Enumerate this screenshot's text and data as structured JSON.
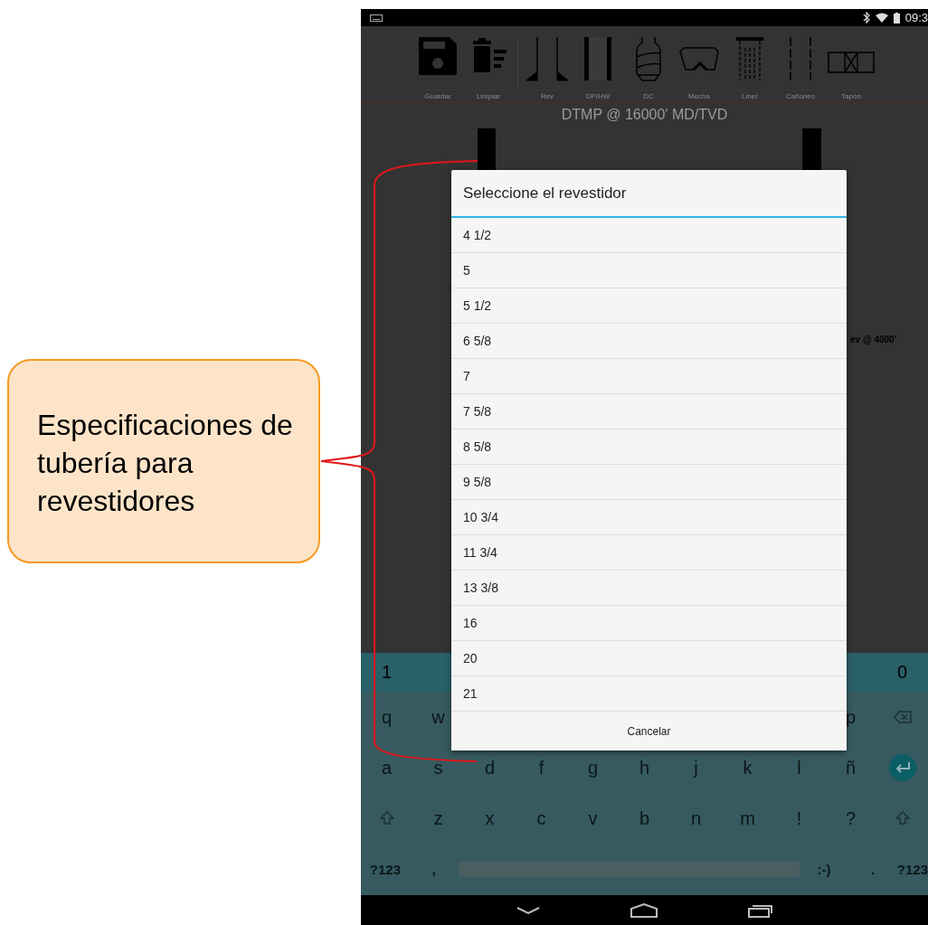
{
  "callout": {
    "text": "Especificaciones de tubería para revestidores"
  },
  "status_bar": {
    "time": "09:3"
  },
  "toolbar": {
    "file_tools": [
      {
        "label": "Guardar",
        "kind": "save"
      },
      {
        "label": "Limpiar",
        "kind": "clear"
      }
    ],
    "element_tools": [
      {
        "label": "Rev",
        "kind": "rev"
      },
      {
        "label": "DP/HW",
        "kind": "pipe"
      },
      {
        "label": "DC",
        "kind": "collar"
      },
      {
        "label": "Mecha",
        "kind": "bit"
      },
      {
        "label": "Liner",
        "kind": "liner"
      },
      {
        "label": "Cañoneo",
        "kind": "perforation"
      },
      {
        "label": "Tapón",
        "kind": "plug"
      }
    ]
  },
  "drawing": {
    "title": "DTMP @ 16000' MD/TVD",
    "depth_label": "ev @ 4000'"
  },
  "dialog": {
    "title": "Seleccione el revestidor",
    "options": [
      "4 1/2",
      "5",
      "5 1/2",
      "6 5/8",
      "7",
      "7 5/8",
      "8 5/8",
      "9 5/8",
      "10 3/4",
      "11 3/4",
      "13 3/8",
      "16",
      "20",
      "21"
    ],
    "cancel": "Cancelar"
  },
  "keyboard": {
    "rows": [
      {
        "kind": "number",
        "left": [
          {
            "kind": "char",
            "label": "1"
          }
        ],
        "right": [
          {
            "kind": "char",
            "label": "0"
          }
        ]
      },
      {
        "kind": "letter",
        "left": [
          {
            "kind": "char",
            "label": "q"
          },
          {
            "kind": "char",
            "label": "w"
          }
        ],
        "right": [
          {
            "kind": "char",
            "label": "p"
          },
          {
            "kind": "backspace"
          }
        ]
      },
      {
        "kind": "letter",
        "left": [
          {
            "kind": "char",
            "label": "a"
          },
          {
            "kind": "char",
            "label": "s"
          },
          {
            "kind": "char",
            "label": "d"
          },
          {
            "kind": "char",
            "label": "f"
          },
          {
            "kind": "char",
            "label": "g"
          },
          {
            "kind": "char",
            "label": "h"
          },
          {
            "kind": "char",
            "label": "j"
          },
          {
            "kind": "char",
            "label": "k"
          },
          {
            "kind": "char",
            "label": "l"
          },
          {
            "kind": "char",
            "label": "ñ"
          },
          {
            "kind": "enter"
          }
        ],
        "right": []
      },
      {
        "kind": "letter",
        "left": [
          {
            "kind": "shift"
          },
          {
            "kind": "char",
            "label": "z"
          },
          {
            "kind": "char",
            "label": "x"
          },
          {
            "kind": "char",
            "label": "c"
          },
          {
            "kind": "char",
            "label": "v"
          },
          {
            "kind": "char",
            "label": "b"
          },
          {
            "kind": "char",
            "label": "n"
          },
          {
            "kind": "char",
            "label": "m"
          },
          {
            "kind": "char",
            "label": "!"
          },
          {
            "kind": "char",
            "label": "?"
          },
          {
            "kind": "shift"
          }
        ],
        "right": []
      },
      {
        "kind": "letter",
        "left": [
          {
            "kind": "small",
            "label": "?123"
          },
          {
            "kind": "small",
            "label": ","
          },
          {
            "kind": "space"
          },
          {
            "kind": "small",
            "label": ":-)"
          },
          {
            "kind": "small",
            "label": "."
          },
          {
            "kind": "small",
            "label": "?123"
          }
        ],
        "right": []
      }
    ]
  }
}
